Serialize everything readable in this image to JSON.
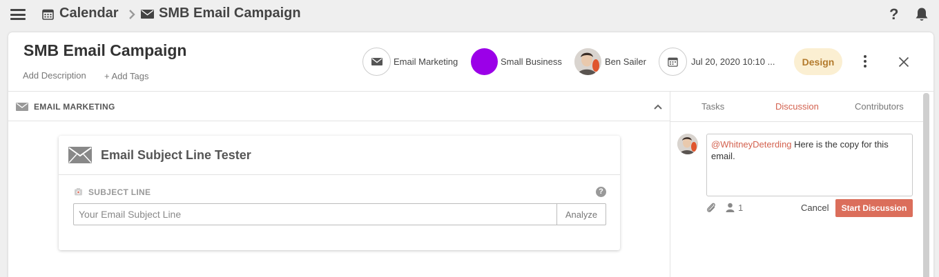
{
  "breadcrumb": {
    "root": "Calendar",
    "current": "SMB Email Campaign"
  },
  "header": {
    "title": "SMB Email Campaign",
    "add_description": "Add Description",
    "add_tags": "+ Add Tags",
    "channel": "Email Marketing",
    "segment": "Small Business",
    "segment_color": "#9b00e8",
    "owner": "Ben Sailer",
    "date": "Jul 20, 2020 10:10 ...",
    "status": "Design"
  },
  "section": {
    "title": "EMAIL MARKETING"
  },
  "tester": {
    "title": "Email Subject Line Tester",
    "subject_label": "SUBJECT LINE",
    "help": "?",
    "input_placeholder": "Your Email Subject Line",
    "input_value": "",
    "analyze_label": "Analyze"
  },
  "tabs": [
    {
      "label": "Tasks",
      "active": false
    },
    {
      "label": "Discussion",
      "active": true
    },
    {
      "label": "Contributors",
      "active": false
    }
  ],
  "discussion": {
    "mention": "@WhitneyDeterding",
    "message": " Here is the copy for this email.",
    "participant_count": "1",
    "cancel_label": "Cancel",
    "start_label": "Start Discussion"
  },
  "colors": {
    "accent": "#d3614e",
    "primary_button": "#db6e5b",
    "status_badge_bg": "#fbefd2",
    "status_badge_text": "#b37a2c"
  },
  "icons": {
    "menu": "hamburger-icon",
    "calendar": "calendar-icon",
    "mail": "envelope-icon",
    "help": "question-icon",
    "notifications": "bell-icon",
    "attach": "paperclip-icon",
    "person": "person-icon"
  }
}
